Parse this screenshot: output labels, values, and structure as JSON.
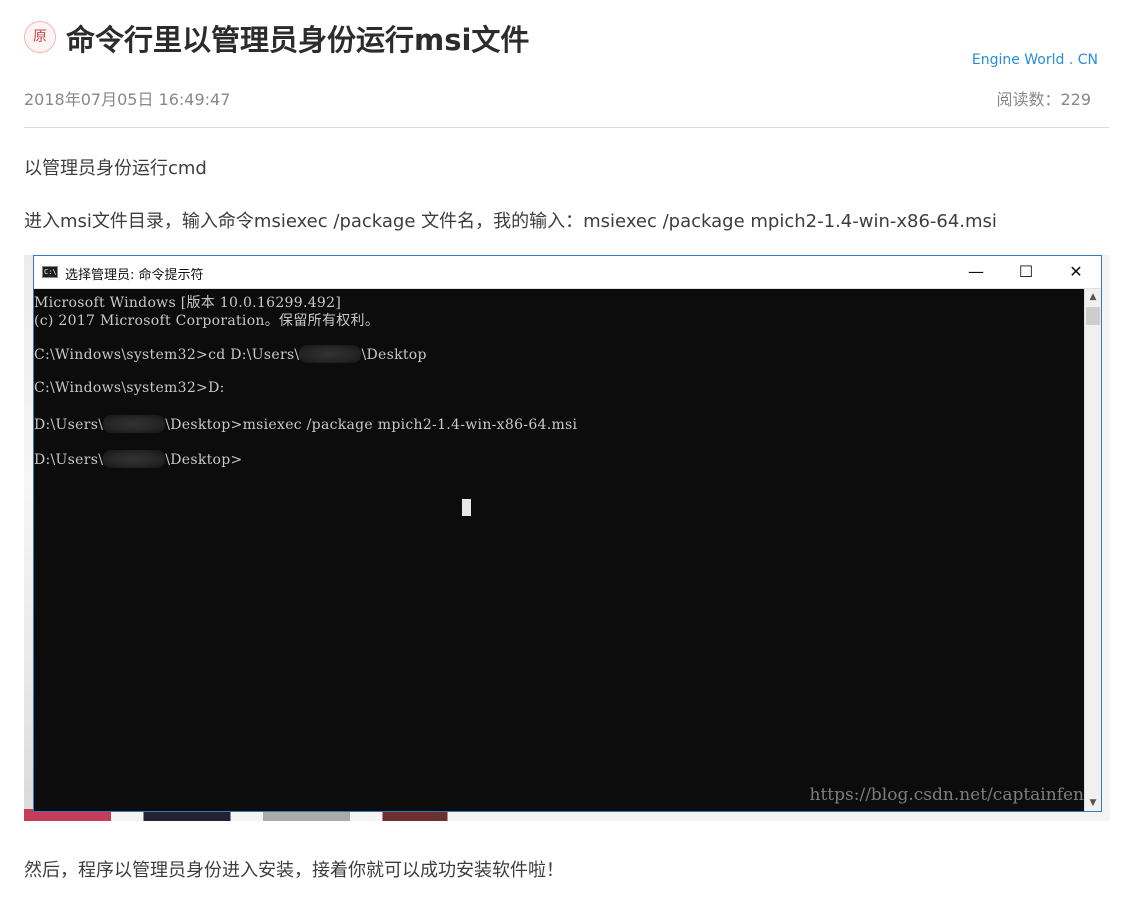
{
  "header": {
    "badge": "原",
    "title": "命令行里以管理员身份运行msi文件",
    "site_link": "Engine World . CN",
    "date": "2018年07月05日 16:49:47",
    "read_count": "阅读数：229"
  },
  "content": {
    "para1": "以管理员身份运行cmd",
    "para2": "进入msi文件目录，输入命令msiexec /package 文件名，我的输入：msiexec /package mpich2-1.4-win-x86-64.msi",
    "para3": "然后，程序以管理员身份进入安装，接着你就可以成功安装软件啦！"
  },
  "cmd_window": {
    "app_icon": "C:\\",
    "title": "选择管理员: 命令提示符",
    "btn_minimize": "—",
    "btn_maximize": "☐",
    "btn_close": "✕",
    "lines": {
      "l1": "Microsoft Windows [版本 10.0.16299.492]",
      "l2": "(c) 2017 Microsoft Corporation。保留所有权利。",
      "l3a": "C:\\Windows\\system32>cd D:\\Users\\",
      "l3b": "\\Desktop",
      "l4": "C:\\Windows\\system32>D:",
      "l5a": "D:\\Users\\",
      "l5b": "\\Desktop>msiexec /package mpich2-1.4-win-x86-64.msi",
      "l6a": "D:\\Users\\",
      "l6b": "\\Desktop>"
    },
    "watermark": "https://blog.csdn.net/captainfen",
    "scroll_up": "▲",
    "scroll_down": "▼"
  }
}
